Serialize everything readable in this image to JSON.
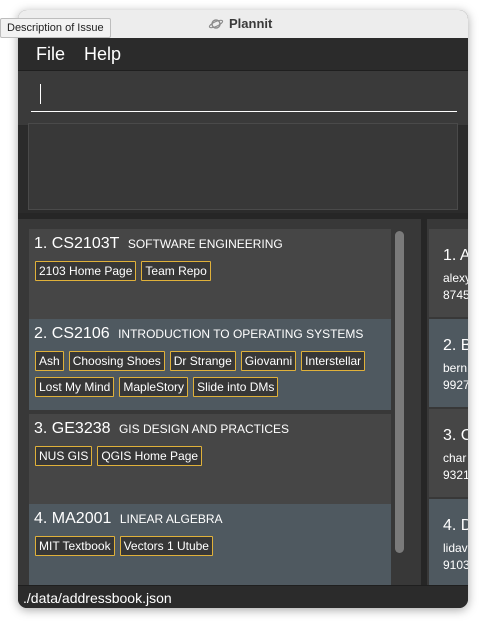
{
  "window": {
    "title": "Plannit",
    "tooltip": "Description of Issue"
  },
  "menu": [
    "File",
    "Help"
  ],
  "command_box": {
    "value": ""
  },
  "result_display": {
    "text": ""
  },
  "modules": [
    {
      "index": "1.",
      "code": "CS2103T",
      "name": "SOFTWARE ENGINEERING",
      "tags": [
        "2103 Home Page",
        "Team Repo"
      ]
    },
    {
      "index": "2.",
      "code": "CS2106",
      "name": "INTRODUCTION TO OPERATING SYSTEMS",
      "tags": [
        "Ash",
        "Choosing Shoes",
        "Dr Strange",
        "Giovanni",
        "Interstellar",
        "Lost My Mind",
        "MapleStory",
        "Slide into DMs"
      ]
    },
    {
      "index": "3.",
      "code": "GE3238",
      "name": "GIS DESIGN AND PRACTICES",
      "tags": [
        "NUS GIS",
        "QGIS Home Page"
      ]
    },
    {
      "index": "4.",
      "code": "MA2001",
      "name": "LINEAR ALGEBRA",
      "tags": [
        "MIT Textbook",
        "Vectors 1 Utube"
      ]
    }
  ],
  "persons": [
    {
      "index": "1.",
      "name_partial": "A",
      "line1": "alexy",
      "line2": "8745"
    },
    {
      "index": "2.",
      "name_partial": "B",
      "line1": "bern",
      "line2": "9927"
    },
    {
      "index": "3.",
      "name_partial": "C",
      "line1": "char",
      "line2": "9321"
    },
    {
      "index": "4.",
      "name_partial": "D",
      "line1": "lidav",
      "line2": "9103"
    }
  ],
  "status": {
    "path": "./data/addressbook.json"
  }
}
